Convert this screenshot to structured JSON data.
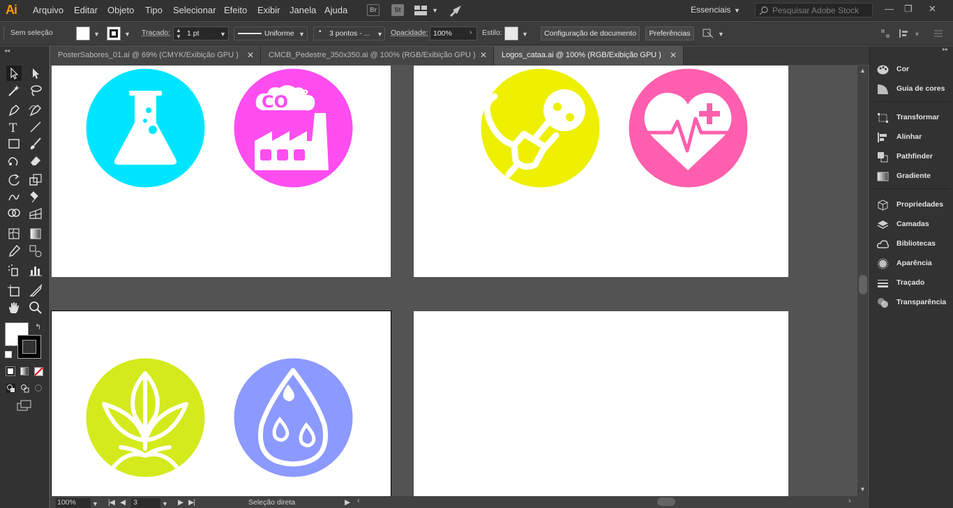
{
  "app": {
    "logo": "Ai"
  },
  "menu": [
    "Arquivo",
    "Editar",
    "Objeto",
    "Tipo",
    "Selecionar",
    "Efeito",
    "Exibir",
    "Janela",
    "Ajuda"
  ],
  "bridge_icons": {
    "br": "Br",
    "st": "St"
  },
  "workspace": "Essenciais",
  "search": {
    "placeholder": "Pesquisar Adobe Stock"
  },
  "window_controls": {
    "minimize": "—",
    "restore": "❐",
    "close": "✕"
  },
  "control": {
    "selection": "Sem seleção",
    "stroke_label": "Traçado:",
    "stroke_weight": "1 pt",
    "profile": "Uniforme",
    "brush": "3 pontos - ...",
    "opacity_label": "Opacidade:",
    "opacity": "100%",
    "style_label": "Estilo:",
    "doc_setup": "Configuração de documento",
    "prefs": "Preferências"
  },
  "tabs": [
    {
      "label": "PosterSabores_01.ai @ 69% (CMYK/Exibição GPU )",
      "active": false
    },
    {
      "label": "CMCB_Pedestre_350x350.ai @ 100% (RGB/Exibição GPU )",
      "active": false
    },
    {
      "label": "Logos_cataa.ai @ 100% (RGB/Exibição GPU )",
      "active": true
    }
  ],
  "tab_close": "✕",
  "icons": [
    {
      "name": "science-flask",
      "color": "#00e5ff"
    },
    {
      "name": "co2-factory",
      "color": "#ff4df0",
      "text": "CO",
      "sup": "2"
    },
    {
      "name": "power-plug",
      "color": "#eef000"
    },
    {
      "name": "heart-health",
      "color": "#ff5fae"
    },
    {
      "name": "plant-leaves",
      "color": "#d4ea1c"
    },
    {
      "name": "water-drops",
      "color": "#8c99ff"
    }
  ],
  "panels": [
    {
      "label": "Cor",
      "icon": "palette-icon"
    },
    {
      "label": "Guia de cores",
      "icon": "color-guide-icon"
    },
    {
      "label": "Transformar",
      "icon": "transform-icon"
    },
    {
      "label": "Alinhar",
      "icon": "align-icon"
    },
    {
      "label": "Pathfinder",
      "icon": "pathfinder-icon"
    },
    {
      "label": "Gradiente",
      "icon": "gradient-icon"
    },
    {
      "label": "Propriedades",
      "icon": "properties-icon"
    },
    {
      "label": "Camadas",
      "icon": "layers-icon"
    },
    {
      "label": "Bibliotecas",
      "icon": "libraries-icon"
    },
    {
      "label": "Aparência",
      "icon": "appearance-icon"
    },
    {
      "label": "Traçado",
      "icon": "stroke-icon"
    },
    {
      "label": "Transparência",
      "icon": "transparency-icon"
    }
  ],
  "status": {
    "zoom": "100%",
    "artboard": "3",
    "tool": "Seleção direta"
  }
}
